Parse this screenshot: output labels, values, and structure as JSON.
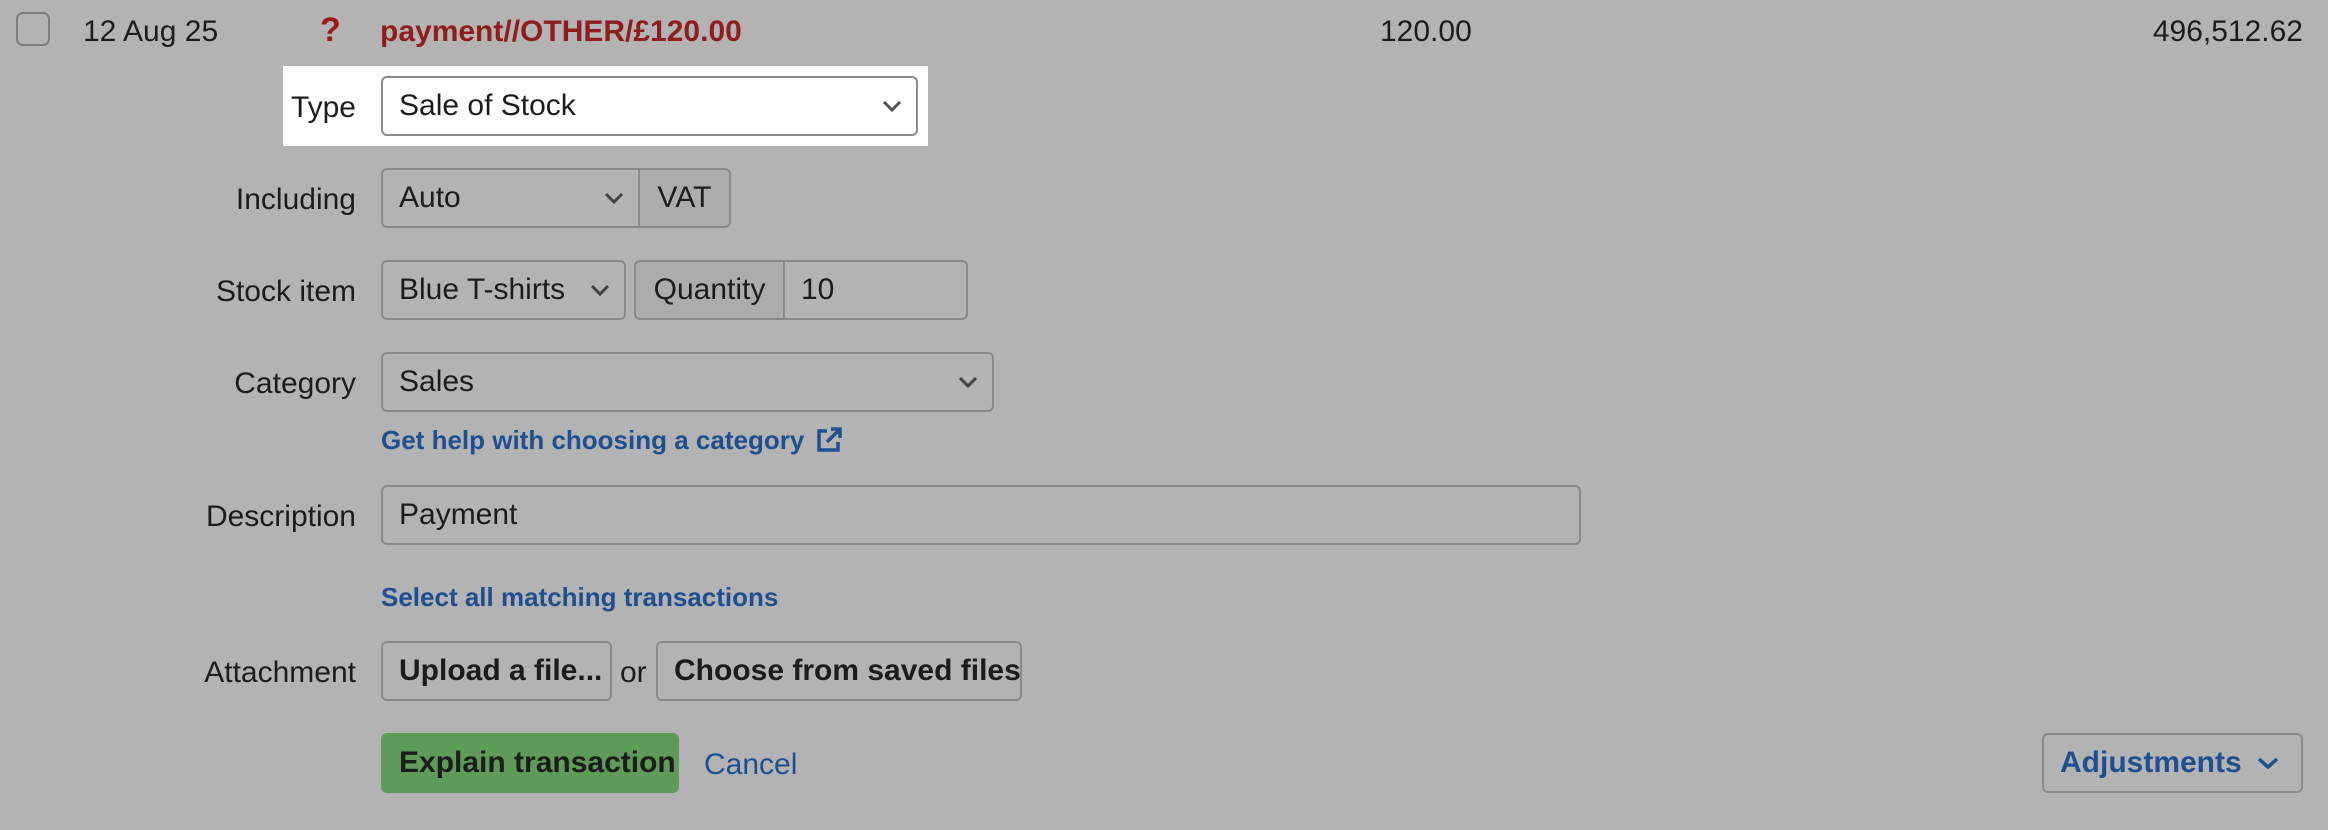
{
  "row": {
    "date": "12 Aug 25",
    "flag": "?",
    "description": "payment//OTHER/£120.00",
    "amount": "120.00",
    "balance": "496,512.62"
  },
  "form": {
    "type": {
      "label": "Type",
      "value": "Sale of Stock"
    },
    "including": {
      "label": "Including",
      "value": "Auto",
      "addon": "VAT"
    },
    "stock_item": {
      "label": "Stock item",
      "value": "Blue T-shirts",
      "quantity_label": "Quantity",
      "quantity_value": "10"
    },
    "category": {
      "label": "Category",
      "value": "Sales",
      "help_link": "Get help with choosing a category"
    },
    "description": {
      "label": "Description",
      "value": "Payment"
    },
    "select_matching_link": "Select all matching transactions",
    "attachment": {
      "label": "Attachment",
      "upload_button": "Upload a file...",
      "or_text": "or",
      "choose_button": "Choose from saved files"
    }
  },
  "actions": {
    "explain": "Explain transaction",
    "cancel": "Cancel",
    "adjustments": "Adjustments"
  },
  "colors": {
    "background": "#b3b3b3",
    "highlight": "#ffffff",
    "link": "#1f4f8f",
    "primary": "#5e9b59",
    "row_description": "#8f1d1d"
  },
  "icons": [
    "chevron-down-icon",
    "external-link-icon",
    "question-mark-icon"
  ]
}
